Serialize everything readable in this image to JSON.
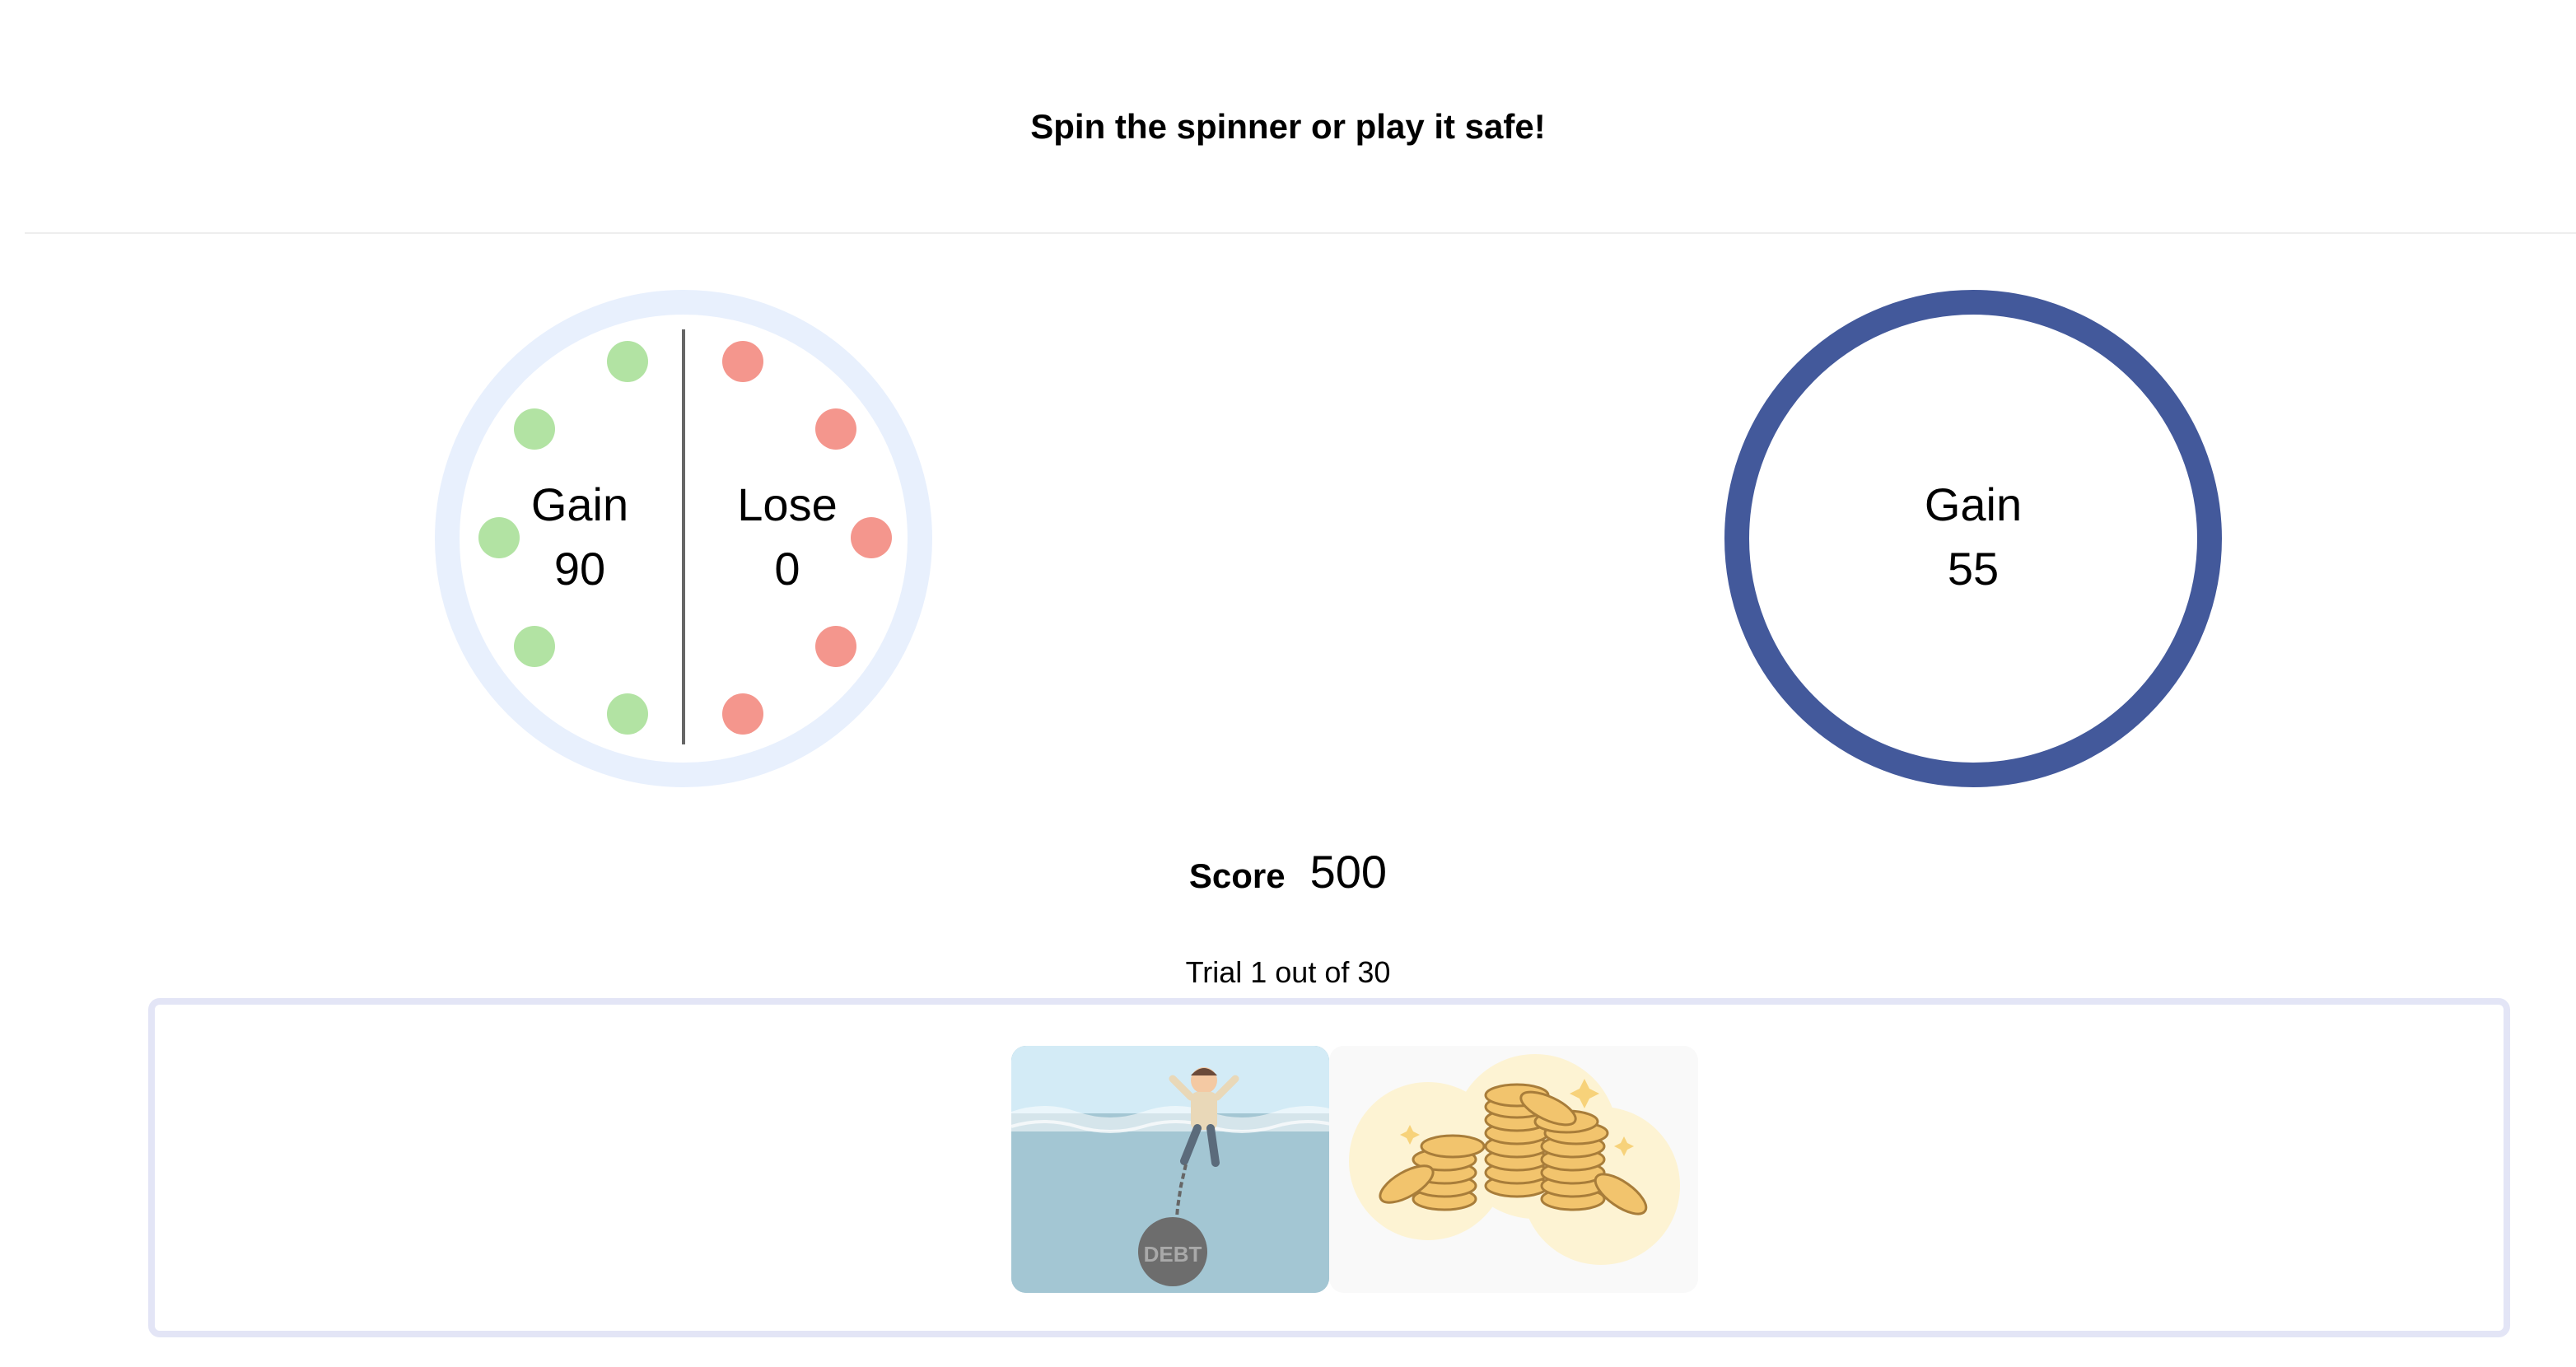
{
  "header": {
    "title": "Spin the spinner or play it safe!"
  },
  "spinner": {
    "gain_label": "Gain",
    "gain_value": "90",
    "lose_label": "Lose",
    "lose_value": "0",
    "gain_color": "#b2e3a3",
    "lose_color": "#f4968d",
    "ring_color": "#e8f0fd"
  },
  "safe_option": {
    "label": "Gain",
    "value": "55",
    "ring_color": "#43599b"
  },
  "score": {
    "label": "Score",
    "value": "500"
  },
  "trial": {
    "text": "Trial 1 out of 30"
  },
  "images": {
    "left": {
      "icon": "debt-drowning-illustration",
      "text": "DEBT"
    },
    "right": {
      "icon": "gold-coins-illustration"
    }
  }
}
